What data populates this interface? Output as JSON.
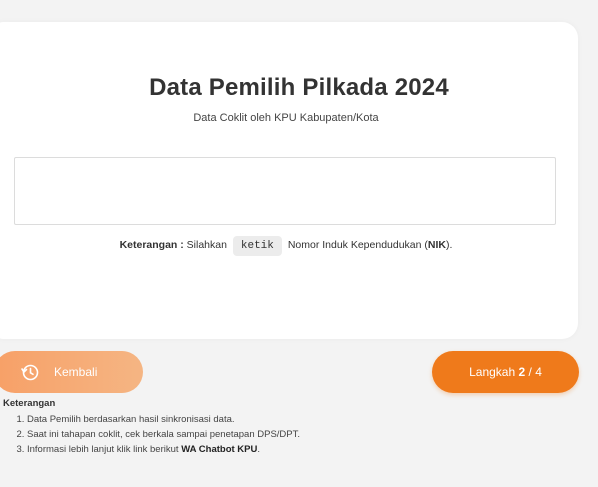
{
  "card": {
    "title": "Data Pemilih Pilkada 2024",
    "subtitle": "Data Coklit oleh KPU Kabupaten/Kota",
    "nik_input": {
      "value": "",
      "placeholder": ""
    },
    "hint": {
      "label": "Keterangan :",
      "prefix": "Silahkan",
      "code": "ketik",
      "middle": "Nomor Induk Kependudukan (",
      "bold": "NIK",
      "suffix": ")."
    }
  },
  "buttons": {
    "back": {
      "label": "Kembali",
      "icon": "back-clock-icon"
    },
    "step": {
      "prefix": "Langkah",
      "current": "2",
      "total": "/ 4"
    }
  },
  "notes": {
    "title": "Keterangan",
    "items": [
      {
        "text": "Data Pemilih berdasarkan hasil sinkronisasi data.",
        "bold": ""
      },
      {
        "text": "Saat ini tahapan coklit, cek berkala sampai penetapan DPS/DPT.",
        "bold": ""
      },
      {
        "text": "Informasi lebih lanjut klik link berikut",
        "bold": "WA Chatbot KPU",
        "suffix": "."
      }
    ]
  },
  "colors": {
    "accent": "#ef7a1b",
    "accent_light": "#f7a067",
    "background": "#f3f3f3",
    "card": "#ffffff"
  }
}
